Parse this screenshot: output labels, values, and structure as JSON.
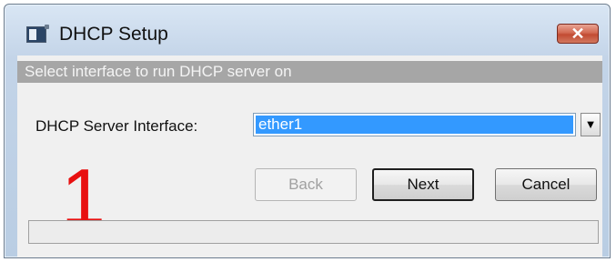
{
  "window": {
    "title": "DHCP Setup",
    "close_symbol": "✕",
    "icon": "app-window-icon"
  },
  "banner": {
    "text": "Select interface to run DHCP server on"
  },
  "form": {
    "interface_label": "DHCP Server Interface:",
    "interface_value": "ether1",
    "dropdown_icon": "▼"
  },
  "overlay": {
    "annotation": "1",
    "color": "#e81010"
  },
  "buttons": {
    "back": "Back",
    "next": "Next",
    "cancel": "Cancel"
  },
  "status": {
    "text": ""
  }
}
